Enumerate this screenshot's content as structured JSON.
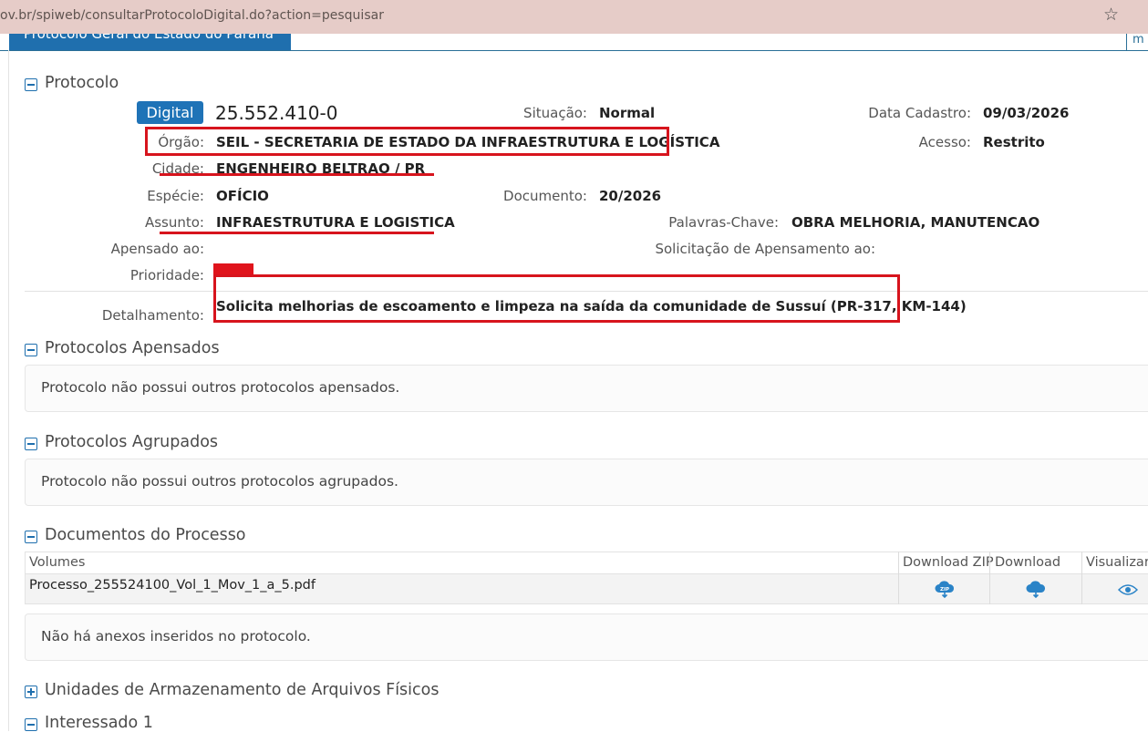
{
  "browser": {
    "url": "ov.br/spiweb/consultarProtocoloDigital.do?action=pesquisar"
  },
  "page_header": {
    "tab_title": "Protocolo Geral do Estado do Paraná",
    "right_tab": "m"
  },
  "protocolo": {
    "section_title": "Protocolo",
    "badge": "Digital",
    "number": "25.552.410-0",
    "situacao_label": "Situação:",
    "situacao_value": "Normal",
    "data_cadastro_label": "Data Cadastro:",
    "data_cadastro_value": "09/03/2026",
    "orgao_label": "Órgão:",
    "orgao_value": "SEIL - SECRETARIA DE ESTADO DA INFRAESTRUTURA E LOGÍSTICA",
    "acesso_label": "Acesso:",
    "acesso_value": "Restrito",
    "cidade_label": "Cidade:",
    "cidade_value": "ENGENHEIRO BELTRAO / PR",
    "especie_label": "Espécie:",
    "especie_value": "OFÍCIO",
    "documento_label": "Documento:",
    "documento_value": "20/2026",
    "assunto_label": "Assunto:",
    "assunto_value": "INFRAESTRUTURA E LOGISTICA",
    "palavras_label": "Palavras-Chave:",
    "palavras_value": "OBRA MELHORIA, MANUTENCAO",
    "apensado_label": "Apensado ao:",
    "solicitacao_label": "Solicitação de Apensamento ao:",
    "prioridade_label": "Prioridade:",
    "detalhamento_label": "Detalhamento:",
    "detalhamento_value": "Solicita melhorias de escoamento e limpeza na saída da comunidade de Sussuí (PR-317, KM-144)"
  },
  "apensados": {
    "section_title": "Protocolos Apensados",
    "message": "Protocolo não possui outros protocolos apensados."
  },
  "agrupados": {
    "section_title": "Protocolos Agrupados",
    "message": "Protocolo não possui outros protocolos agrupados."
  },
  "documentos": {
    "section_title": "Documentos do Processo",
    "columns": [
      "Volumes",
      "Download ZIP",
      "Download",
      "Visualizar"
    ],
    "rows": [
      {
        "file": "Processo_255524100_Vol_1_Mov_1_a_5.pdf"
      }
    ],
    "anexos_message": "Não há anexos inseridos no protocolo.",
    "icons": {
      "zip": "zip-download-icon",
      "download": "cloud-download-icon",
      "view": "eye-icon"
    }
  },
  "armazenamento": {
    "section_title": "Unidades de Armazenamento de Arquivos Físicos"
  },
  "interessado": {
    "section_title": "Interessado 1"
  },
  "colors": {
    "accent": "#1f73b7",
    "annotation_red": "#d7141d",
    "address_bar": "#e6ccc8"
  }
}
